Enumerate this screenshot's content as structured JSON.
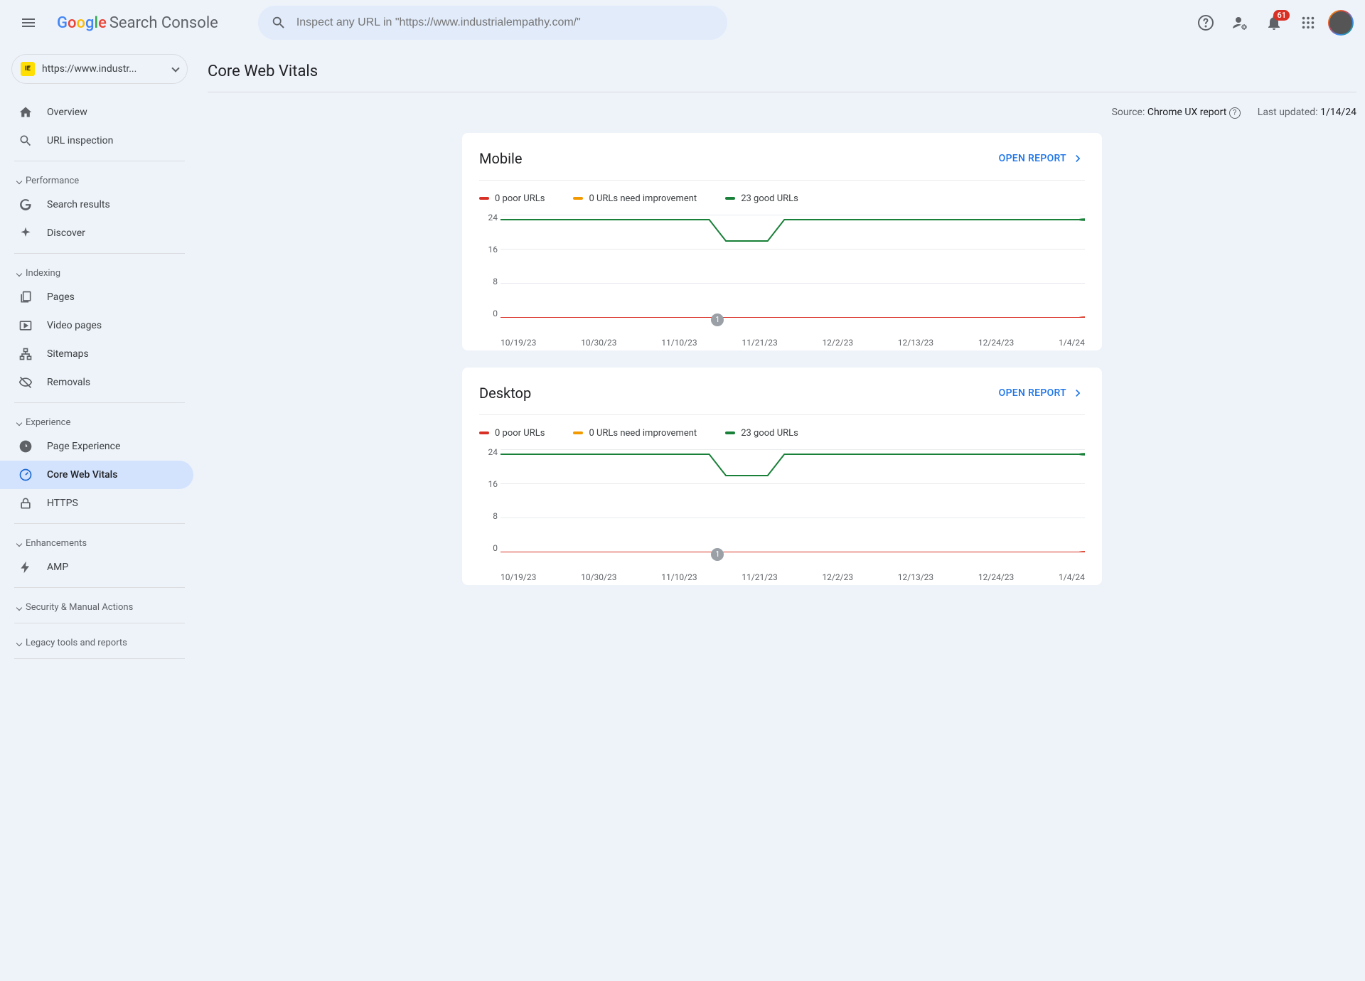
{
  "header": {
    "product_name": "Search Console",
    "search_placeholder": "Inspect any URL in \"https://www.industrialempathy.com/\"",
    "notification_count": "61"
  },
  "property": {
    "label": "https://www.industr..."
  },
  "sidebar": {
    "overview": "Overview",
    "url_inspection": "URL inspection",
    "sec_performance": "Performance",
    "search_results": "Search results",
    "discover": "Discover",
    "sec_indexing": "Indexing",
    "pages": "Pages",
    "video_pages": "Video pages",
    "sitemaps": "Sitemaps",
    "removals": "Removals",
    "sec_experience": "Experience",
    "page_experience": "Page Experience",
    "core_web_vitals": "Core Web Vitals",
    "https": "HTTPS",
    "sec_enhancements": "Enhancements",
    "amp": "AMP",
    "security": "Security & Manual Actions",
    "legacy": "Legacy tools and reports"
  },
  "page": {
    "title": "Core Web Vitals",
    "source_label": "Source:",
    "source_value": "Chrome UX report",
    "updated_label": "Last updated:",
    "updated_value": "1/14/24",
    "open_report": "OPEN REPORT"
  },
  "cards": {
    "mobile": {
      "title": "Mobile"
    },
    "desktop": {
      "title": "Desktop"
    }
  },
  "legend": {
    "poor": "0 poor URLs",
    "needs": "0 URLs need improvement",
    "good": "23 good URLs"
  },
  "colors": {
    "poor": "#d93025",
    "needs": "#f29900",
    "good": "#188038"
  },
  "chart_data": [
    {
      "name": "mobile",
      "type": "line",
      "title": "Mobile",
      "ylim": [
        0,
        24
      ],
      "yticks": [
        0,
        8,
        16,
        24
      ],
      "categories": [
        "10/19/23",
        "10/30/23",
        "11/10/23",
        "11/21/23",
        "12/2/23",
        "12/13/23",
        "12/24/23",
        "1/4/24"
      ],
      "series": [
        {
          "name": "good",
          "values": [
            23,
            23,
            23,
            18,
            23,
            23,
            23,
            23
          ]
        },
        {
          "name": "needs",
          "values": [
            0,
            0,
            0,
            0,
            0,
            0,
            0,
            0
          ]
        },
        {
          "name": "poor",
          "values": [
            0,
            0,
            0,
            0,
            0,
            0,
            0,
            0
          ]
        }
      ],
      "event_marker": {
        "label": "1",
        "x_index": 2.6
      }
    },
    {
      "name": "desktop",
      "type": "line",
      "title": "Desktop",
      "ylim": [
        0,
        24
      ],
      "yticks": [
        0,
        8,
        16,
        24
      ],
      "categories": [
        "10/19/23",
        "10/30/23",
        "11/10/23",
        "11/21/23",
        "12/2/23",
        "12/13/23",
        "12/24/23",
        "1/4/24"
      ],
      "series": [
        {
          "name": "good",
          "values": [
            23,
            23,
            23,
            18,
            23,
            23,
            23,
            23
          ]
        },
        {
          "name": "needs",
          "values": [
            0,
            0,
            0,
            0,
            0,
            0,
            0,
            0
          ]
        },
        {
          "name": "poor",
          "values": [
            0,
            0,
            0,
            0,
            0,
            0,
            0,
            0
          ]
        }
      ],
      "event_marker": {
        "label": "1",
        "x_index": 2.6
      }
    }
  ]
}
